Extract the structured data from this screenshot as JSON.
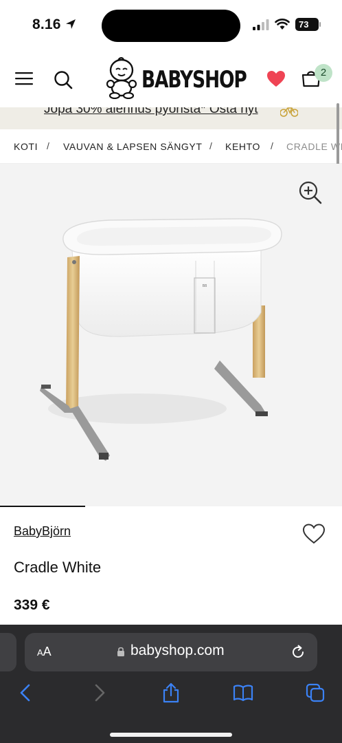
{
  "status_bar": {
    "time": "8.16",
    "battery": "73"
  },
  "header": {
    "logo_text": "BABYSHOP",
    "cart_count": "2"
  },
  "promo": {
    "text": "Jopa 30% alennus pyöristä* Osta nyt"
  },
  "breadcrumb": {
    "items": [
      "KOTI",
      "VAUVAN & LAPSEN SÄNGYT",
      "KEHTO",
      "CRADLE WHITE"
    ],
    "separator": "/"
  },
  "product": {
    "brand": "BabyBjörn",
    "title": "Cradle White",
    "price": "339 €",
    "image_count_shown": 1
  },
  "browser": {
    "aa_label_small": "A",
    "aa_label_large": "A",
    "url": "babyshop.com"
  },
  "colors": {
    "heart": "#ef4454",
    "badge_bg": "#bfe3c8",
    "promo_bg": "#efede6",
    "safari_bar": "#2b2b2d",
    "safari_accent": "#3b82f6"
  }
}
